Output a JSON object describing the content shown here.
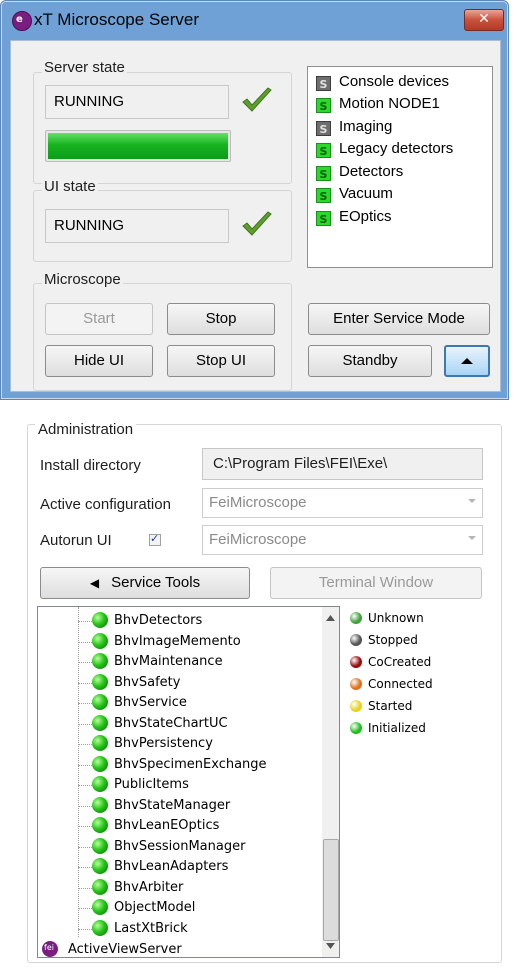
{
  "window": {
    "title": "xT Microscope Server",
    "close_glyph": "✕",
    "app_icon_letter": "e"
  },
  "server_state": {
    "label": "Server state",
    "value": "RUNNING",
    "progress": 1.0
  },
  "ui_state": {
    "label": "UI state",
    "value": "RUNNING"
  },
  "microscope": {
    "label": "Microscope",
    "start_label": "Start",
    "stop_label": "Stop",
    "hide_ui_label": "Hide UI",
    "stop_ui_label": "Stop UI"
  },
  "devices": [
    {
      "badge": "S",
      "status": "stopped",
      "name": "Console devices"
    },
    {
      "badge": "S",
      "status": "started",
      "name": "Motion NODE1"
    },
    {
      "badge": "S",
      "status": "stopped",
      "name": "Imaging"
    },
    {
      "badge": "S",
      "status": "started",
      "name": "Legacy detectors"
    },
    {
      "badge": "S",
      "status": "started",
      "name": "Detectors"
    },
    {
      "badge": "S",
      "status": "started",
      "name": "Vacuum"
    },
    {
      "badge": "S",
      "status": "started",
      "name": "EOptics"
    }
  ],
  "actions": {
    "service_mode_label": "Enter Service Mode",
    "standby_label": "Standby"
  },
  "administration": {
    "label": "Administration",
    "install_dir_label": "Install directory",
    "install_dir_value": "C:\\Program Files\\FEI\\Exe\\",
    "active_config_label": "Active configuration",
    "active_config_value": "FeiMicroscope",
    "autorun_label": "Autorun UI",
    "autorun_checked": true,
    "check_glyph": "✓",
    "autorun_value": "FeiMicroscope",
    "service_tools_label": "Service Tools",
    "service_tools_arrow": "◀",
    "terminal_label": "Terminal Window"
  },
  "tree": {
    "items": [
      "BhvDetectors",
      "BhvImageMemento",
      "BhvMaintenance",
      "BhvSafety",
      "BhvService",
      "BhvStateChartUC",
      "BhvPersistency",
      "BhvSpecimenExchange",
      "PublicItems",
      "BhvStateManager",
      "BhvLeanEOptics",
      "BhvSessionManager",
      "BhvLeanAdapters",
      "BhvArbiter",
      "ObjectModel",
      "LastXtBrick"
    ],
    "root_item": "ActiveViewServer",
    "root_icon_text": "fei"
  },
  "legend": [
    {
      "label": "Unknown",
      "color": "#3fa23a"
    },
    {
      "label": "Stopped",
      "color": "#555555"
    },
    {
      "label": "CoCreated",
      "color": "#9b0a0a"
    },
    {
      "label": "Connected",
      "color": "#e0701b"
    },
    {
      "label": "Started",
      "color": "#e8d21a"
    },
    {
      "label": "Initialized",
      "color": "#1fbf1c"
    }
  ],
  "colors": {
    "title_bar": "#6fa0d6",
    "progress_green": "#17b41f",
    "status_started": "#2bd92b",
    "status_stopped": "#6e6e6e",
    "close_red": "#c9523b"
  }
}
